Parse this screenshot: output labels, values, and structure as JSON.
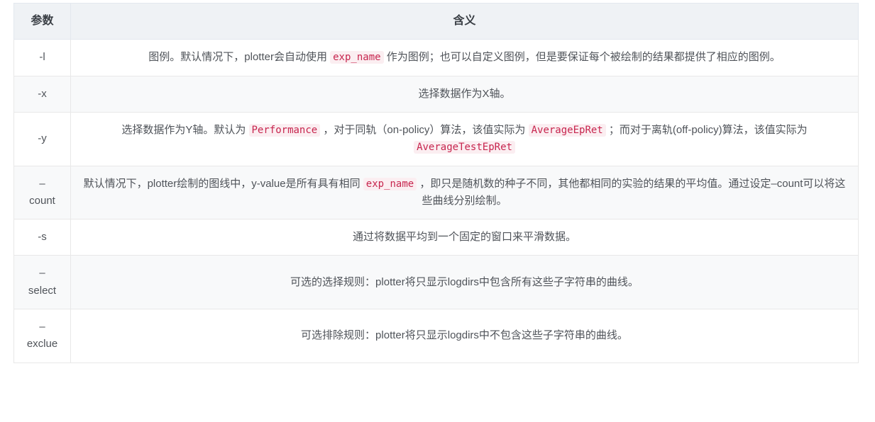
{
  "table": {
    "columns": [
      {
        "key": "param",
        "header": "参数"
      },
      {
        "key": "meaning",
        "header": "含义"
      }
    ],
    "rows": [
      {
        "param": "-l",
        "segments": [
          {
            "type": "text",
            "value": "图例。默认情况下，plotter会自动使用 "
          },
          {
            "type": "code",
            "value": "exp_name"
          },
          {
            "type": "text",
            "value": " 作为图例；也可以自定义图例，但是要保证每个被绘制的结果都提供了相应的图例。"
          }
        ],
        "plain": "图例。默认情况下，plotter会自动使用 exp_name 作为图例；也可以自定义图例，但是要保证每个被绘制的结果都提供了相应的图例。"
      },
      {
        "param": "-x",
        "segments": [
          {
            "type": "text",
            "value": "选择数据作为X轴。"
          }
        ],
        "plain": "选择数据作为X轴。"
      },
      {
        "param": "-y",
        "segments": [
          {
            "type": "text",
            "value": "选择数据作为Y轴。默认为 "
          },
          {
            "type": "code",
            "value": "Performance"
          },
          {
            "type": "text",
            "value": " ，对于同轨（on-policy）算法，该值实际为 "
          },
          {
            "type": "code",
            "value": "AverageEpRet"
          },
          {
            "type": "text",
            "value": " ；而对于离轨(off-policy)算法，该值实际为 "
          },
          {
            "type": "code",
            "value": "AverageTestEpRet"
          }
        ],
        "plain": "选择数据作为Y轴。默认为 Performance ，对于同轨（on-policy）算法，该值实际为 AverageEpRet ；而对于离轨(off-policy)算法，该值实际为 AverageTestEpRet"
      },
      {
        "param": "–\ncount",
        "param_lines": [
          "–",
          "count"
        ],
        "segments": [
          {
            "type": "text",
            "value": "默认情况下，plotter绘制的图线中，y-value是所有具有相同 "
          },
          {
            "type": "code",
            "value": "exp_name"
          },
          {
            "type": "text",
            "value": " ，即只是随机数的种子不同，其他都相同的实验的结果的平均值。通过设定–count可以将这些曲线分别绘制。"
          }
        ],
        "plain": "默认情况下，plotter绘制的图线中，y-value是所有具有相同 exp_name ，即只是随机数的种子不同，其他都相同的实验的结果的平均值。通过设定–count可以将这些曲线分别绘制。"
      },
      {
        "param": "-s",
        "segments": [
          {
            "type": "text",
            "value": "通过将数据平均到一个固定的窗口来平滑数据。"
          }
        ],
        "plain": "通过将数据平均到一个固定的窗口来平滑数据。"
      },
      {
        "param": "–\nselect",
        "param_lines": [
          "–",
          "select"
        ],
        "segments": [
          {
            "type": "text",
            "value": "可选的选择规则：plotter将只显示logdirs中包含所有这些子字符串的曲线。"
          }
        ],
        "plain": "可选的选择规则：plotter将只显示logdirs中包含所有这些子字符串的曲线。"
      },
      {
        "param": "–\nexclue",
        "param_lines": [
          "–",
          "exclue"
        ],
        "segments": [
          {
            "type": "text",
            "value": "可选排除规则：plotter将只显示logdirs中不包含这些子字符串的曲线。"
          }
        ],
        "plain": "可选排除规则：plotter将只显示logdirs中不包含这些子字符串的曲线。"
      }
    ]
  },
  "colors": {
    "header_bg": "#eff2f5",
    "row_alt_bg": "#f8f9fa",
    "row_bg": "#ffffff",
    "border": "#e8e8e8",
    "code_fg": "#c7254e",
    "code_bg": "#fbeef1",
    "text": "#4f5359"
  }
}
